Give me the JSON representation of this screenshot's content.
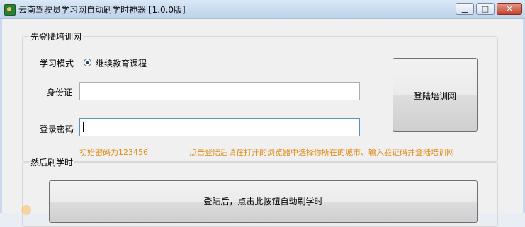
{
  "window": {
    "title": "云南驾驶员学习网自动刷学时神器 [1.0.0版]",
    "minimize_glyph": "▁",
    "maximize_glyph": "□",
    "close_glyph": "✕"
  },
  "login_section": {
    "title": "先登陆培训网",
    "mode_label": "学习模式",
    "mode_option": "继续教育课程",
    "mode_selected": true,
    "id_label": "身份证",
    "id_value": "",
    "password_label": "登录密码",
    "password_value": "",
    "login_button": "登陆培训网",
    "initial_password_hint": "初始密码为123456",
    "login_instruction_hint": "点击登陆后请在打开的浏览器中选择你所在的城市、输入验证码并登陆培训网"
  },
  "study_section": {
    "title": "然后刷学时",
    "auto_study_button": "登陆后，点击此按钮自动刷学时"
  },
  "colors": {
    "hint_text": "#e08a14",
    "title_bar": "#c9dbef",
    "close_button": "#c4432c"
  }
}
